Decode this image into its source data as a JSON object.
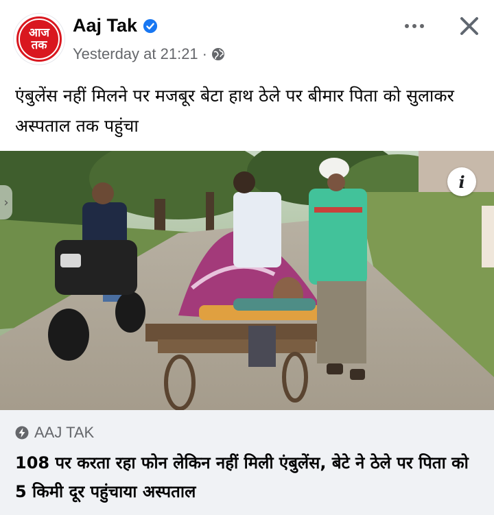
{
  "post": {
    "page_name": "Aaj Tak",
    "avatar_text": "आज\nतक",
    "timestamp": "Yesterday at 21:21",
    "separator": "·",
    "text": "एंबुलेंस नहीं मिलने पर मजबूर बेटा हाथ ठेले पर बीमार पिता को सुलाकर अस्पताल तक पहुंचा"
  },
  "link_card": {
    "source": "AAJ TAK",
    "title": "108 पर करता रहा फोन लेकिन नहीं मिली एंबुलेंस, बेटे ने ठेले पर पिता को 5 किमी दूर पहुंचाया अस्पताल"
  },
  "icons": {
    "verified": "verified-badge-icon",
    "privacy": "globe-icon",
    "more": "more-options-icon",
    "close": "close-icon",
    "info": "info-icon",
    "source": "bolt-icon"
  },
  "colors": {
    "brand_red": "#d9171f",
    "verified_blue": "#1877f2",
    "secondary_text": "#65676b",
    "card_background": "#f0f2f5"
  }
}
